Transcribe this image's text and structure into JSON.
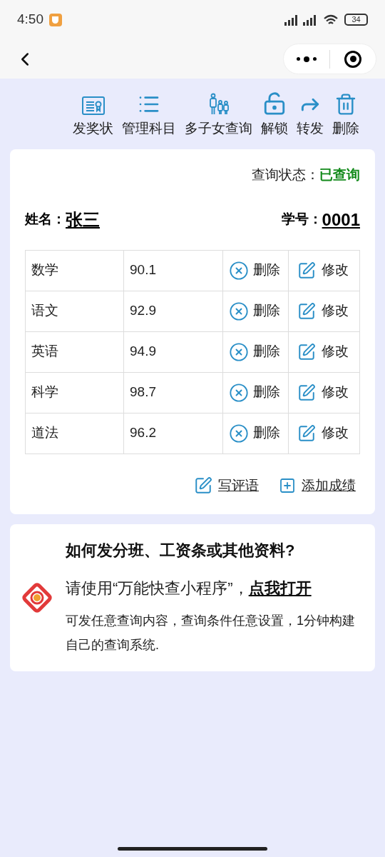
{
  "status_bar": {
    "time": "4:50",
    "battery": "34"
  },
  "toolbar": [
    {
      "kind": "certificate",
      "label": "发奖状"
    },
    {
      "kind": "list",
      "label": "管理科目"
    },
    {
      "kind": "family",
      "label": "多子女查询"
    },
    {
      "kind": "unlock",
      "label": "解锁"
    },
    {
      "kind": "forward",
      "label": "转发"
    },
    {
      "kind": "trash",
      "label": "删除"
    }
  ],
  "query_status": {
    "label": "查询状态：",
    "value": "已查询"
  },
  "student": {
    "name_label": "姓名：",
    "name": "张三",
    "id_label": "学号：",
    "id": "0001"
  },
  "grades": [
    {
      "subject": "数学",
      "score": "90.1",
      "delete": "删除",
      "edit": "修改"
    },
    {
      "subject": "语文",
      "score": "92.9",
      "delete": "删除",
      "edit": "修改"
    },
    {
      "subject": "英语",
      "score": "94.9",
      "delete": "删除",
      "edit": "修改"
    },
    {
      "subject": "科学",
      "score": "98.7",
      "delete": "删除",
      "edit": "修改"
    },
    {
      "subject": "道法",
      "score": "96.2",
      "delete": "删除",
      "edit": "修改"
    }
  ],
  "actions": [
    {
      "kind": "comment",
      "label": "写评语"
    },
    {
      "kind": "add",
      "label": "添加成绩"
    }
  ],
  "promo": {
    "title": "如何发分班、工资条或其他资料?",
    "text": "请使用“万能快查小程序”，",
    "link": "点我打开",
    "description": "可发任意查询内容，查询条件任意设置，1分钟构建自己的查询系统."
  }
}
